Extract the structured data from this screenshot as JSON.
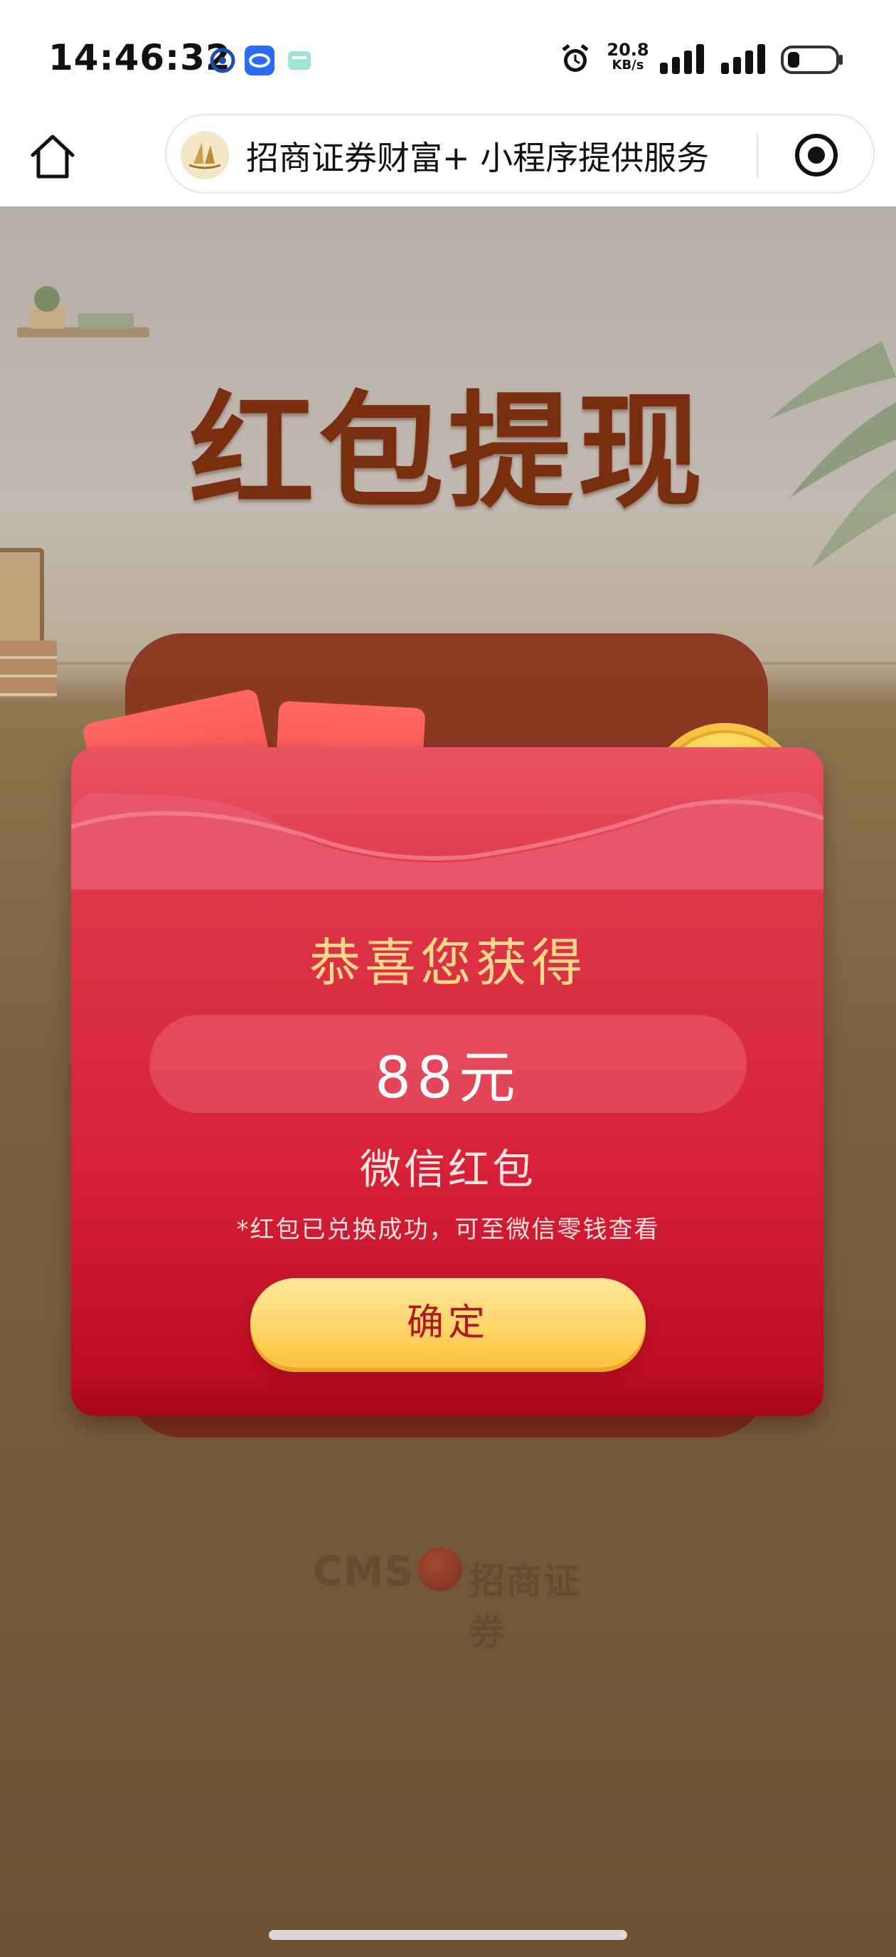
{
  "status_bar": {
    "time": "14:46:32",
    "net_speed_value": "20.8",
    "net_speed_unit": "KB/s",
    "icons": [
      "notification-app-icon",
      "notification-app-icon",
      "notification-app-icon",
      "alarm-icon",
      "signal-icon",
      "signal-icon",
      "battery-icon"
    ]
  },
  "nav": {
    "home_icon": "home-icon",
    "capsule_title": "招商证券财富+ 小程序提供服务",
    "close_icon": "close-target-icon"
  },
  "page": {
    "title": "红包提现",
    "packet_symbol": "¥",
    "congrats": "恭喜您获得",
    "amount": "88元",
    "prize_type": "微信红包",
    "note": "*红包已兑换成功，可至微信零钱查看",
    "confirm_label": "确定"
  },
  "footer": {
    "cms": "CMS",
    "brand": "招商证券"
  },
  "colors": {
    "title": "#7a2e10",
    "envelope_red": "#d52138",
    "congrats_gold": "#ffd98a",
    "button_yellow": "#ffd56a",
    "button_text": "#b4161f"
  }
}
